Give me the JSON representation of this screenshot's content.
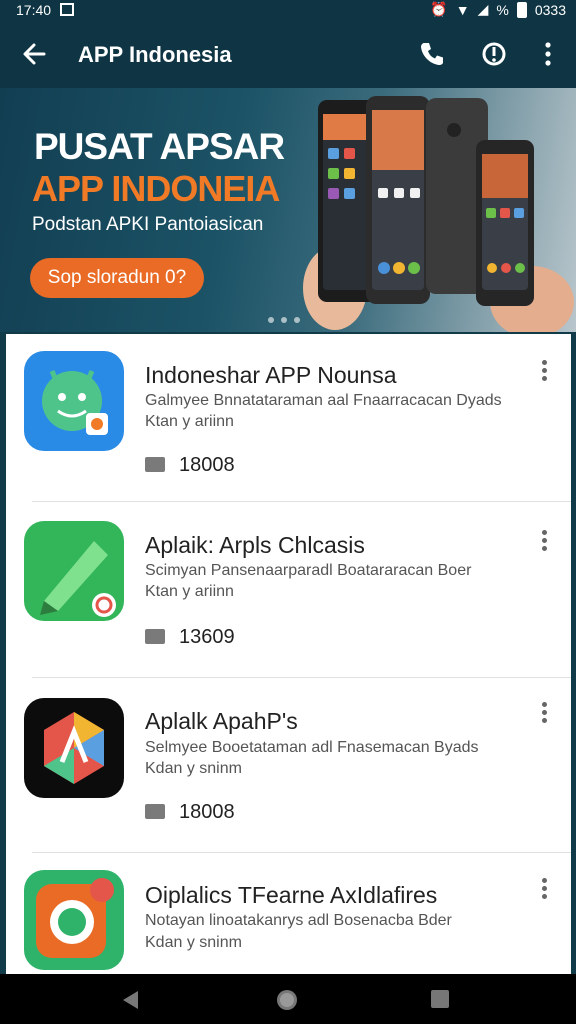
{
  "status_bar": {
    "time": "17:40",
    "battery": "0333"
  },
  "app_bar": {
    "title": "APP Indonesia"
  },
  "banner": {
    "headline": "PUSAT APSAR",
    "headline2": "APP INDONEIA",
    "subtitle": "Podstan APKI Pantoiasican",
    "cta_label": "Sop sloradun 0?",
    "accent_color": "#ea6b25"
  },
  "apps": [
    {
      "name": "Indoneshar APP Nounsa",
      "desc1": "Galmyee Bnnatataraman aal Fnaarracacan Dyads",
      "desc2": "Ktan y ariinn",
      "count": "18008",
      "icon": "android-app-icon"
    },
    {
      "name": "Aplaik: Arpls Chlcasis",
      "desc1": "Scimyan Pansenaarparadl Boatararacan Boer",
      "desc2": "Ktan y ariinn",
      "count": "13609",
      "icon": "pencil-app-icon"
    },
    {
      "name": "Aplalk ApahP's",
      "desc1": "Selmyee Booetataman adl Fnasemacan Byads",
      "desc2": "Kdan y sninm",
      "count": "18008",
      "icon": "hexagon-app-icon"
    },
    {
      "name": "Oiplalics TFearne AxIdlafires",
      "desc1": "Notayan linoatakanrys adl Bosenacba Bder",
      "desc2": "Kdan y sninm",
      "count": "",
      "icon": "phone-app-icon"
    }
  ]
}
